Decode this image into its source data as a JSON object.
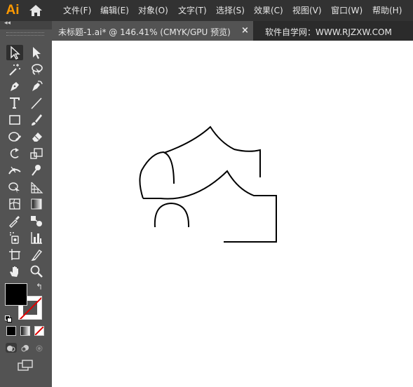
{
  "app": {
    "logo_text": "Ai",
    "brand_color": "#ff9a00"
  },
  "menubar": {
    "items": [
      {
        "label": "文件(F)"
      },
      {
        "label": "编辑(E)"
      },
      {
        "label": "对象(O)"
      },
      {
        "label": "文字(T)"
      },
      {
        "label": "选择(S)"
      },
      {
        "label": "效果(C)"
      },
      {
        "label": "视图(V)"
      },
      {
        "label": "窗口(W)"
      },
      {
        "label": "帮助(H)"
      }
    ]
  },
  "document_tab": {
    "title": "未标题-1.ai* @ 146.41% (CMYK/GPU 预览)",
    "close_label": "×"
  },
  "watermark": "软件自学网：WWW.RJZXW.COM",
  "toolbar": {
    "collapse_label": "◂◂",
    "swap_label": "↰",
    "tools": [
      {
        "name": "selection-tool-icon"
      },
      {
        "name": "direct-selection-tool-icon"
      },
      {
        "name": "magic-wand-tool-icon"
      },
      {
        "name": "lasso-tool-icon"
      },
      {
        "name": "pen-tool-icon"
      },
      {
        "name": "curvature-tool-icon"
      },
      {
        "name": "type-tool-icon"
      },
      {
        "name": "line-segment-tool-icon"
      },
      {
        "name": "rectangle-tool-icon"
      },
      {
        "name": "paintbrush-tool-icon"
      },
      {
        "name": "shaper-tool-icon"
      },
      {
        "name": "eraser-tool-icon"
      },
      {
        "name": "rotate-tool-icon"
      },
      {
        "name": "scale-tool-icon"
      },
      {
        "name": "width-tool-icon"
      },
      {
        "name": "puppet-warp-tool-icon"
      },
      {
        "name": "shape-builder-tool-icon"
      },
      {
        "name": "perspective-grid-tool-icon"
      },
      {
        "name": "mesh-tool-icon"
      },
      {
        "name": "gradient-tool-icon"
      },
      {
        "name": "eyedropper-tool-icon"
      },
      {
        "name": "blend-tool-icon"
      },
      {
        "name": "symbol-sprayer-tool-icon"
      },
      {
        "name": "column-graph-tool-icon"
      },
      {
        "name": "artboard-tool-icon"
      },
      {
        "name": "slice-tool-icon"
      },
      {
        "name": "hand-tool-icon"
      },
      {
        "name": "zoom-tool-icon"
      }
    ],
    "fill_color": "#000000",
    "stroke_color": "none"
  },
  "colors": {
    "menubar_bg": "#323232",
    "toolbar_bg": "#535353",
    "tab_bg": "#535353",
    "canvas_bg": "#ffffff"
  }
}
